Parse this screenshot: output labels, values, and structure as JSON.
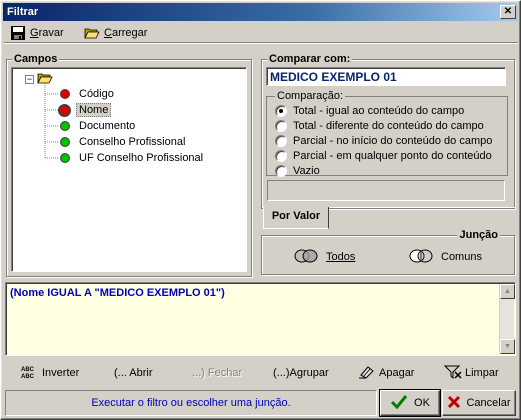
{
  "window": {
    "title": "Filtrar",
    "close_glyph": "✕"
  },
  "toolbar": {
    "items": [
      {
        "label": "Gravar",
        "icon": "floppy-disk-icon"
      },
      {
        "label": "Carregar",
        "icon": "open-folder-icon"
      }
    ]
  },
  "campos": {
    "title": "Campos",
    "tree_toggle": "−",
    "items": [
      {
        "label": "Código",
        "color": "#e00000"
      },
      {
        "label": "Nome",
        "color": "#e00000",
        "selected": true
      },
      {
        "label": "Documento",
        "color": "#00c000"
      },
      {
        "label": "Conselho Profissional",
        "color": "#00c000"
      },
      {
        "label": "UF Conselho Profissional",
        "color": "#00c000"
      }
    ]
  },
  "comparar": {
    "title": "Comparar com:",
    "value": "MEDICO EXEMPLO 01",
    "comparacao_title": "Comparação:",
    "options": [
      {
        "label": "Total - igual ao conteúdo do campo",
        "checked": true
      },
      {
        "label": "Total - diferente do conteúdo do campo",
        "checked": false
      },
      {
        "label": "Parcial - no início do conteúdo do campo",
        "checked": false
      },
      {
        "label": "Parcial - em qualquer ponto do conteúdo",
        "checked": false
      },
      {
        "label": "Vazio",
        "checked": false
      }
    ],
    "tab_label": "Por Valor"
  },
  "juncao": {
    "title": "Junção",
    "buttons": [
      {
        "label": "Todos",
        "icon": "todos-icon"
      },
      {
        "label": "Comuns",
        "icon": "comuns-icon"
      }
    ]
  },
  "expression": {
    "text": "(Nome  IGUAL A  \"MEDICO EXEMPLO 01\")"
  },
  "actions": [
    {
      "label": "Inverter",
      "icon": "invert-icon",
      "enabled": true
    },
    {
      "label": "(... Abrir",
      "icon": "",
      "enabled": true
    },
    {
      "label": "...) Fechar",
      "icon": "",
      "enabled": false
    },
    {
      "label": "(...)Agrupar",
      "icon": "",
      "enabled": true
    },
    {
      "label": "Apagar",
      "icon": "eraser-icon",
      "enabled": true
    },
    {
      "label": "Limpar",
      "icon": "clear-filter-icon",
      "enabled": true
    }
  ],
  "status": {
    "text": "Executar o filtro ou escolher uma junção."
  },
  "buttons": {
    "ok": {
      "label": "OK",
      "icon": "check-icon",
      "color": "#008000"
    },
    "cancel": {
      "label": "Cancelar",
      "icon": "x-icon",
      "color": "#c00000"
    }
  }
}
